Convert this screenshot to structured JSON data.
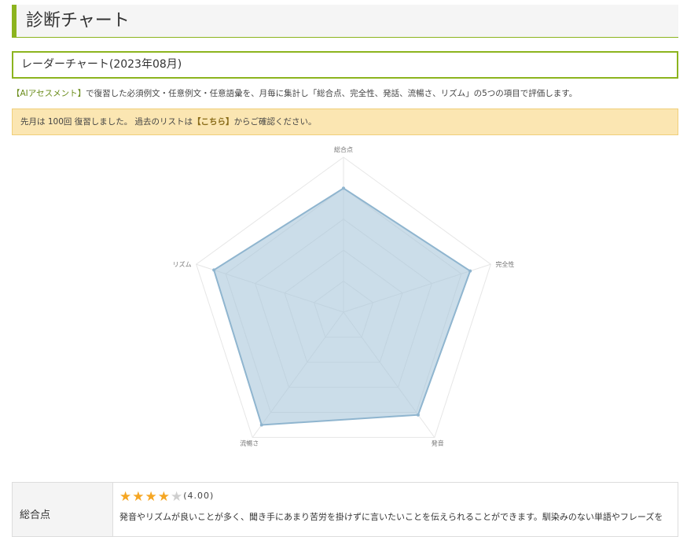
{
  "page": {
    "title": "診断チャート",
    "section_title": "レーダーチャート(2023年08月)",
    "description_link": "【AIアセスメント】",
    "description_rest": "で復習した必須例文・任意例文・任意語彙を、月毎に集計し「総合点、完全性、発話、流暢さ、リズム」の5つの項目で評価します。",
    "notice_before": "先月は 100回 復習しました。 過去のリストは",
    "notice_link": "【こちら】",
    "notice_after": "からご確認ください。"
  },
  "chart_data": {
    "type": "radar",
    "axes": [
      "総合点",
      "完全性",
      "発音",
      "流暢さ",
      "リズム"
    ],
    "values": [
      4.0,
      4.3,
      4.1,
      4.5,
      4.4
    ],
    "rmax": 5,
    "grid_levels": 5,
    "colors": {
      "fill": "#a9c6da",
      "stroke": "#8fb5cf",
      "grid": "#e6e6e6"
    }
  },
  "scores": [
    {
      "label": "総合点",
      "rating": 4,
      "max": 5,
      "value_text": "(4.00)",
      "comment": "発音やリズムが良いことが多く、聞き手にあまり苦労を掛けずに言いたいことを伝えられることができます。馴染みのない単語やフレーズを"
    }
  ]
}
